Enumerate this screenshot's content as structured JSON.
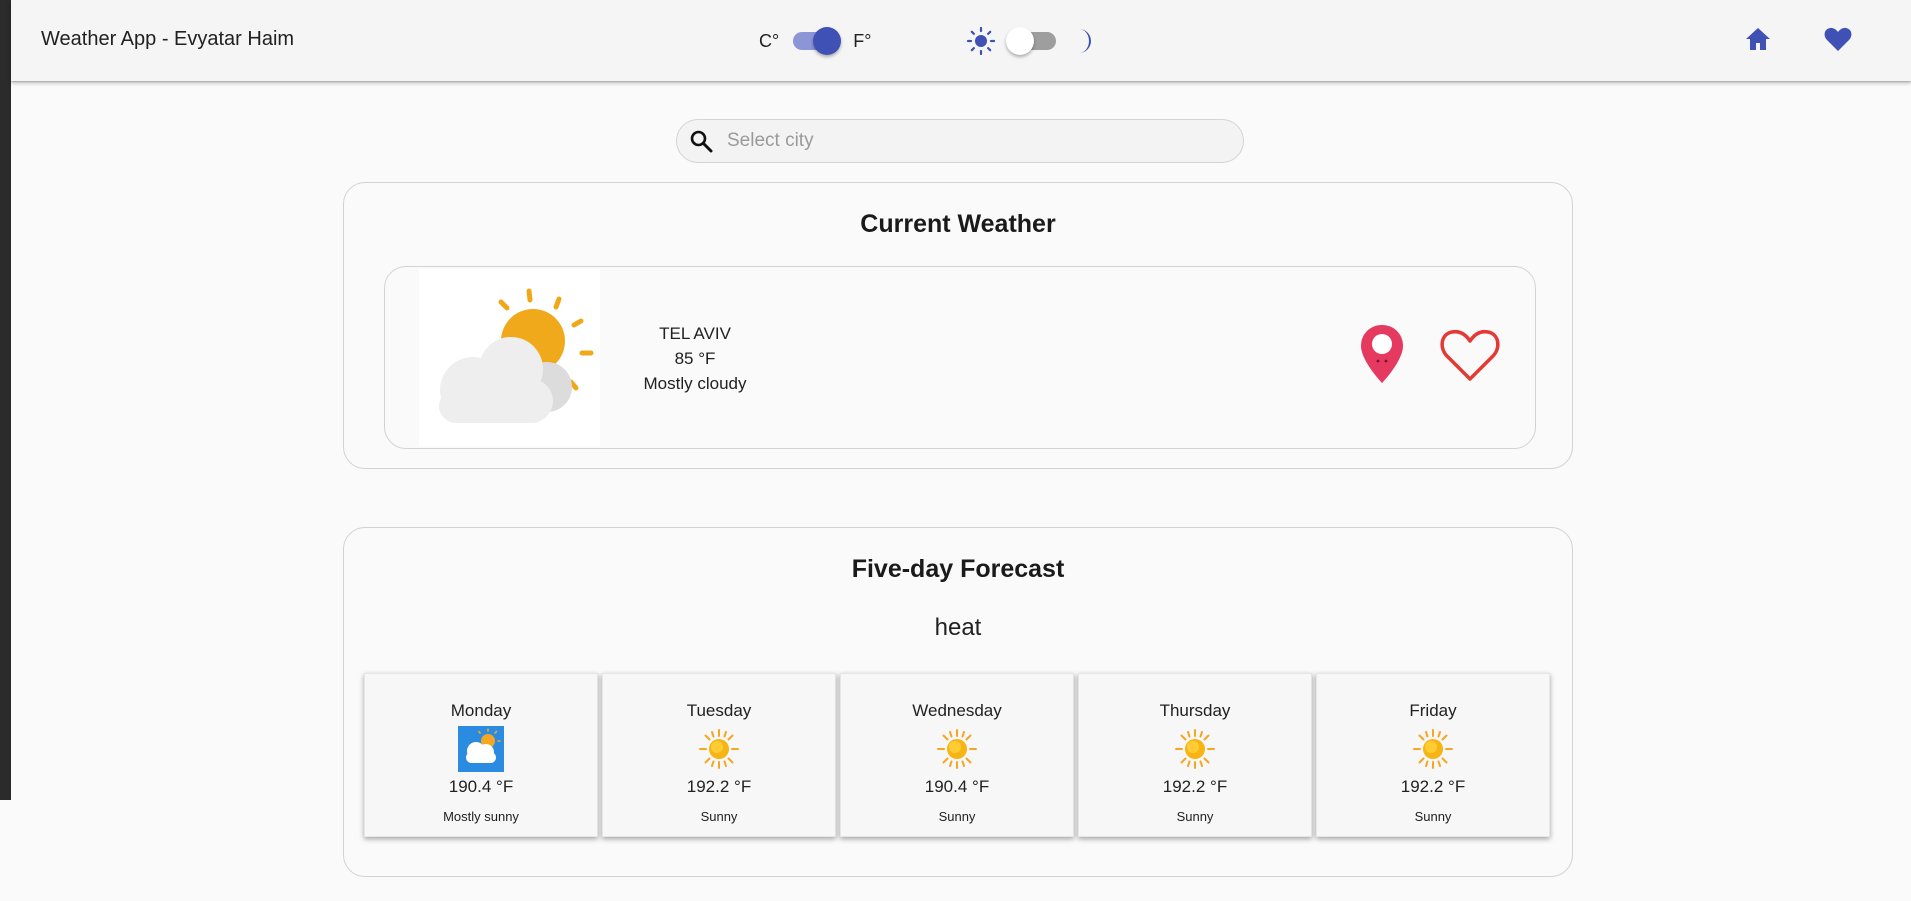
{
  "header": {
    "title": "Weather App - Evyatar Haim",
    "unit_toggle": {
      "left_label": "C°",
      "right_label": "F°",
      "selected": "F°"
    },
    "theme_toggle": {
      "dark_mode": false
    }
  },
  "search": {
    "placeholder": "Select city",
    "value": ""
  },
  "current": {
    "heading": "Current Weather",
    "city": "TEL AVIV",
    "temperature": "85 °F",
    "condition": "Mostly cloudy"
  },
  "forecast": {
    "heading": "Five-day Forecast",
    "headline": "heat",
    "days": [
      {
        "day": "Monday",
        "temp": "190.4 °F",
        "desc": "Mostly sunny",
        "icon": "partly-cloudy-icon"
      },
      {
        "day": "Tuesday",
        "temp": "192.2 °F",
        "desc": "Sunny",
        "icon": "sun-icon"
      },
      {
        "day": "Wednesday",
        "temp": "190.4 °F",
        "desc": "Sunny",
        "icon": "sun-icon"
      },
      {
        "day": "Thursday",
        "temp": "192.2 °F",
        "desc": "Sunny",
        "icon": "sun-icon"
      },
      {
        "day": "Friday",
        "temp": "192.2 °F",
        "desc": "Sunny",
        "icon": "sun-icon"
      }
    ]
  },
  "colors": {
    "accent": "#3f51b5",
    "pin": "#e53960",
    "heart_outline": "#e53935",
    "sun": "#f0a81a"
  }
}
